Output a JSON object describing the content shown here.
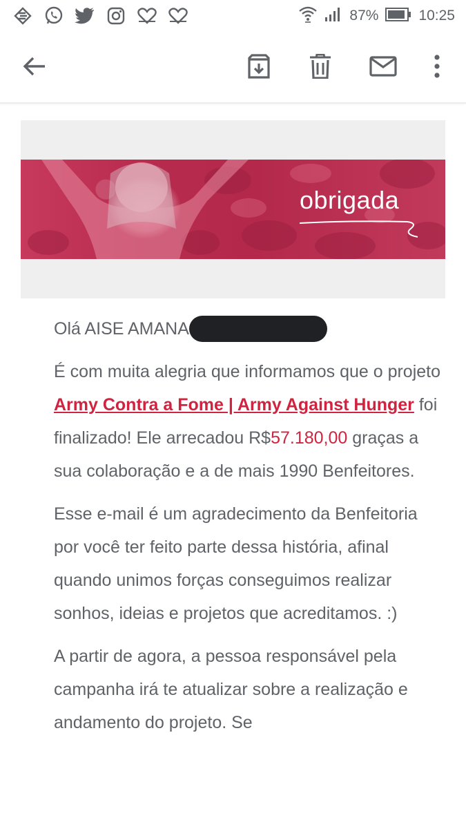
{
  "status_bar": {
    "battery_percent": "87%",
    "time": "10:25",
    "left_icons": [
      "app-icon",
      "whatsapp-icon",
      "twitter-icon",
      "instagram-icon",
      "heart-outline-icon",
      "heart-outline-icon"
    ],
    "right_icons": [
      "wifi-icon",
      "signal-icon",
      "battery-icon"
    ]
  },
  "toolbar": {
    "icons": [
      "back-arrow-icon",
      "archive-icon",
      "delete-icon",
      "mark-unread-icon",
      "more-vert-icon"
    ]
  },
  "banner": {
    "title": "obrigada",
    "color": "#b72b4f"
  },
  "email": {
    "greeting": "Olá AISE AMANA",
    "p1_intro": "É com muita alegria que informamos que o projeto ",
    "project_link": "Army Contra a Fome | Army Against Hunger",
    "p1_mid": " foi finalizado! Ele arrecadou R$",
    "amount": "57.180,00",
    "p1_end": " graças a sua colaboração e a de mais 1990 Benfeitores.",
    "p2": "Esse e-mail é um agradecimento da Benfeitoria por você ter feito parte dessa história, afinal quando unimos forças conseguimos realizar sonhos, ideias e projetos que acreditamos. :)",
    "p3": "A partir de agora, a pessoa responsável pela campanha irá te atualizar sobre a realização e andamento do projeto. Se"
  },
  "colors": {
    "accent": "#d0233f",
    "text": "#5f6368"
  }
}
